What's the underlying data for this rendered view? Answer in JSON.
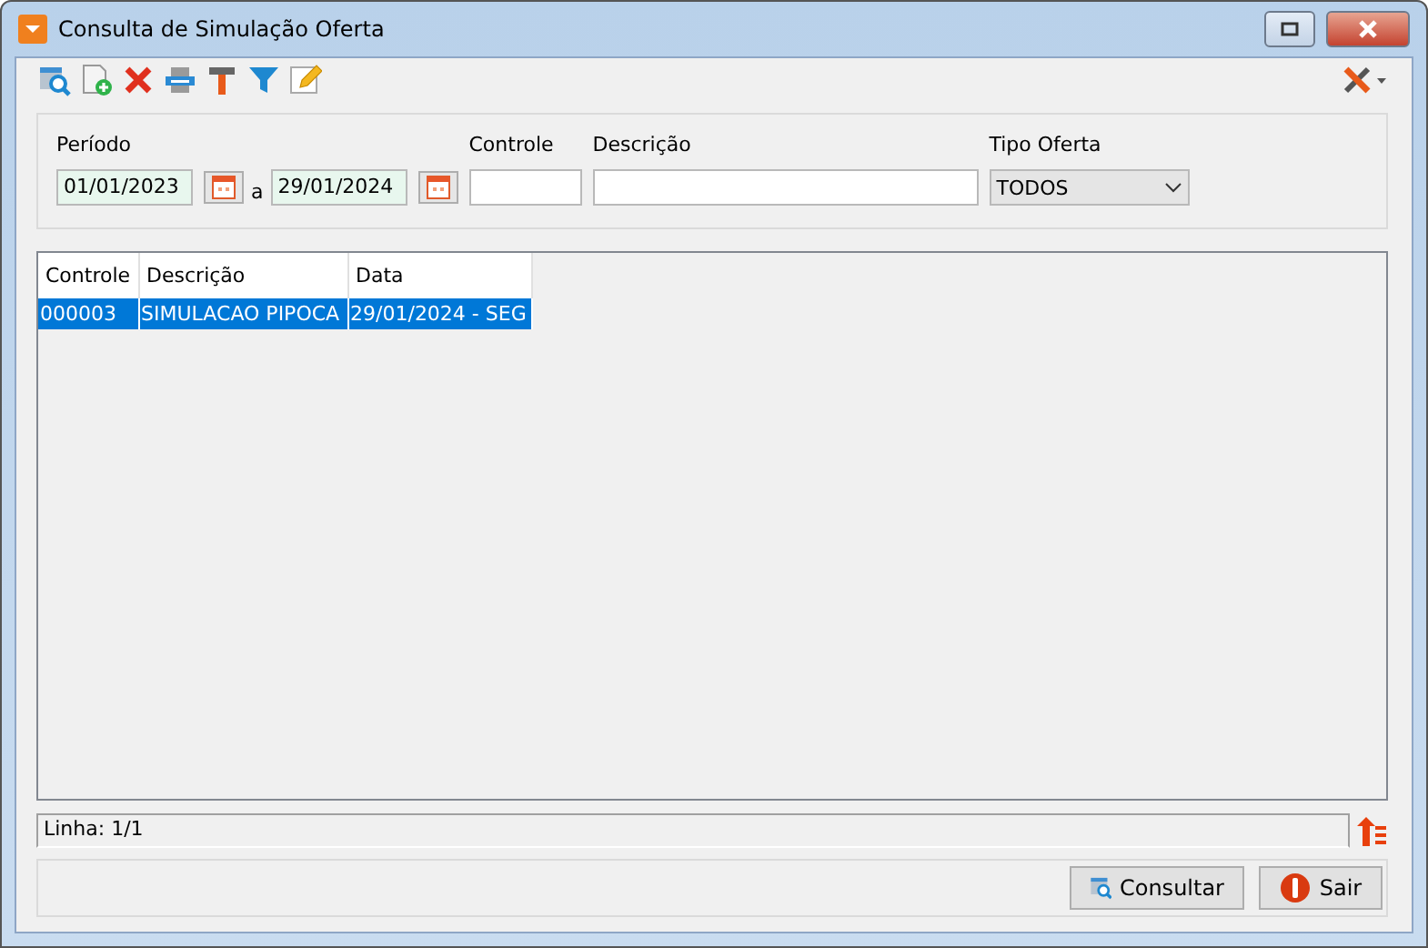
{
  "window": {
    "title": "Consulta de Simulação Oferta"
  },
  "filters": {
    "periodo_label": "Período",
    "date_from": "01/01/2023",
    "separator": "a",
    "date_to": "29/01/2024",
    "controle_label": "Controle",
    "descricao_label": "Descrição",
    "tipo_label": "Tipo Oferta",
    "tipo_value": "TODOS"
  },
  "table": {
    "columns": [
      "Controle",
      "Descrição",
      "Data"
    ],
    "rows": [
      {
        "cells": [
          "000003",
          "SIMULACAO PIPOCA",
          "29/01/2024 - SEG"
        ],
        "selected": true
      }
    ]
  },
  "status_bar": {
    "text": "Linha: 1/1"
  },
  "buttons": [
    {
      "kind": "search",
      "label": "Consultar"
    },
    {
      "kind": "exit",
      "label": "Sair"
    }
  ]
}
